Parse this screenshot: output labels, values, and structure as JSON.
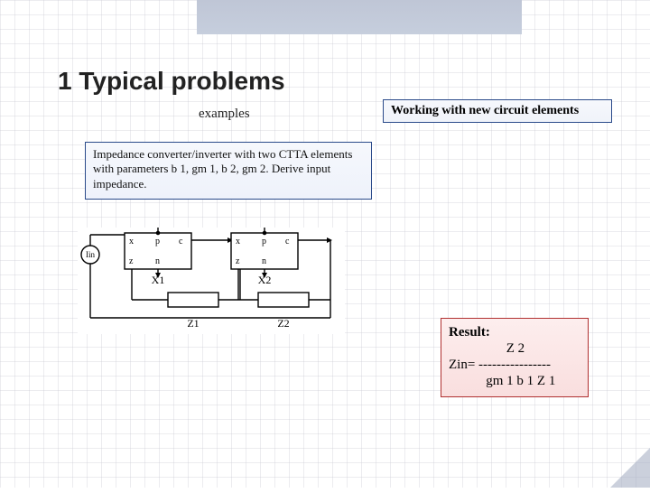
{
  "heading": "1 Typical problems",
  "subhead": "examples",
  "badge_right": "Working with new circuit elements",
  "problem_text": "Impedance converter/inverter with two CTTA elements with parameters b 1, gm 1, b 2, gm 2. Derive input impedance.",
  "circuit": {
    "iin_label": "Iin",
    "x1_label": "X1",
    "x2_label": "X2",
    "z1_label": "Z1",
    "z2_label": "Z2",
    "port_x": "x",
    "port_z": "z",
    "port_p": "p",
    "port_n": "n",
    "port_c": "c"
  },
  "result": {
    "title": "Result:",
    "num_line": "                 Z 2",
    "frac_line": "Zin= ----------------",
    "den_line": "           gm 1 b 1 Z 1"
  }
}
